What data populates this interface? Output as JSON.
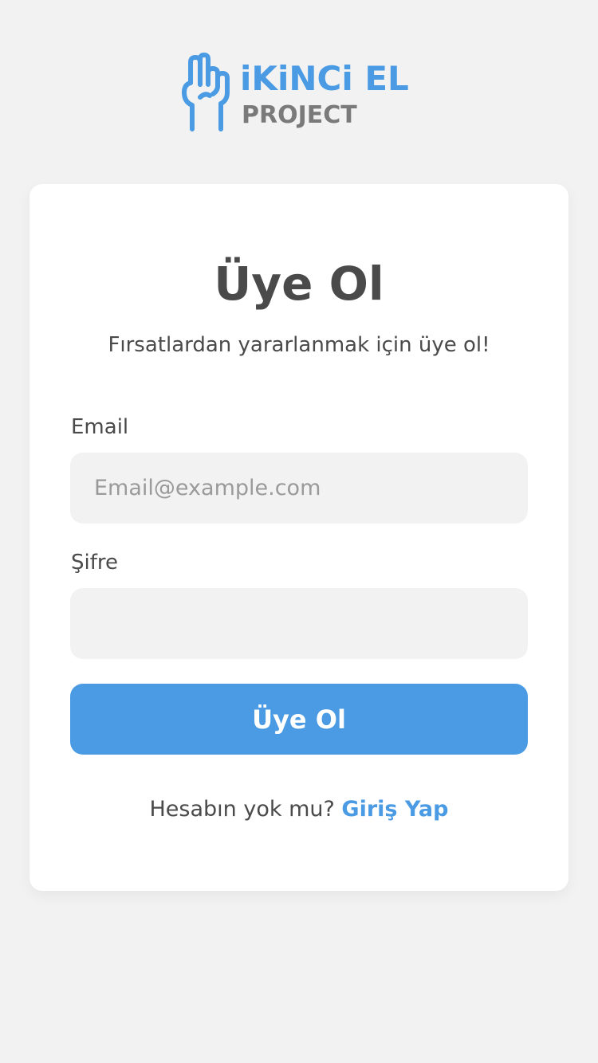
{
  "logo": {
    "title": "iKiNCi EL",
    "subtitle": "PROJECT",
    "icon": "hand-two-fingers-icon",
    "color_primary": "#4a9be3",
    "color_secondary": "#7a7a7a"
  },
  "form": {
    "title": "Üye Ol",
    "subtitle": "Fırsatlardan yararlanmak için üye ol!",
    "email_label": "Email",
    "email_placeholder": "Email@example.com",
    "email_value": "",
    "password_label": "Şifre",
    "password_placeholder": "",
    "password_value": "",
    "submit_label": "Üye Ol"
  },
  "footer": {
    "prompt": "Hesabın yok mu?",
    "link_label": "Giriş Yap"
  },
  "colors": {
    "background": "#f2f2f2",
    "card": "#ffffff",
    "accent": "#4a9be3",
    "text": "#4a4a4a",
    "input_bg": "#f2f2f2"
  }
}
